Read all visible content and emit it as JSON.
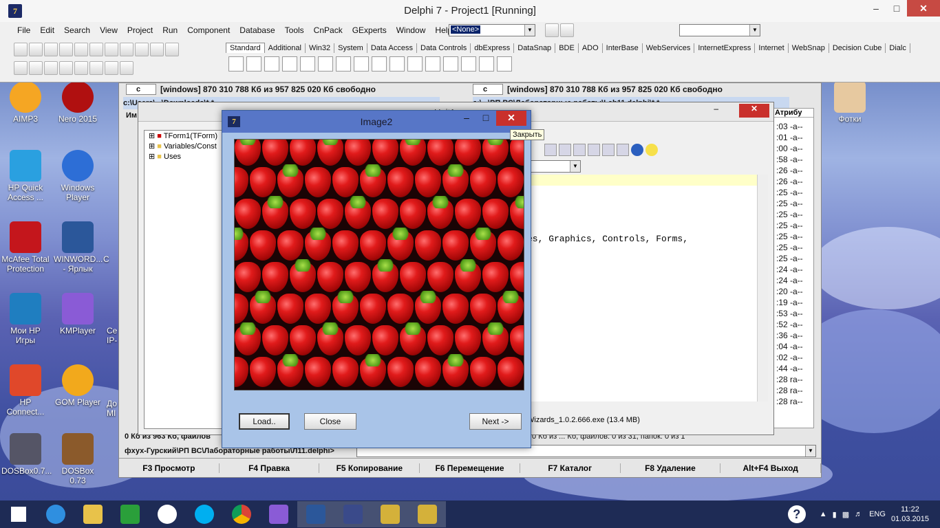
{
  "ide": {
    "title": "Delphi 7 - Project1 [Running]",
    "icon": "delphi-icon",
    "menu": [
      "File",
      "Edit",
      "Search",
      "View",
      "Project",
      "Run",
      "Component",
      "Database",
      "Tools",
      "CnPack",
      "GExperts",
      "Window",
      "Help"
    ],
    "combo_value": "<None>",
    "palette_tabs": [
      "Standard",
      "Additional",
      "Win32",
      "System",
      "Data Access",
      "Data Controls",
      "dbExpress",
      "DataSnap",
      "BDE",
      "ADO",
      "InterBase",
      "WebServices",
      "InternetExpress",
      "Internet",
      "WebSnap",
      "Decision Cube",
      "Dialc"
    ]
  },
  "desktop": {
    "icons": [
      {
        "label": "AIMP3",
        "color": "#f5a623"
      },
      {
        "label": "Nero 2015",
        "color": "#b01010"
      },
      {
        "label": "HP Quick Access ...",
        "color": "#2aa0e0"
      },
      {
        "label": "Windows Player",
        "color": "#2d6ed6"
      },
      {
        "label": "McAfee Total Protection",
        "color": "#c4161c"
      },
      {
        "label": "WINWORD... - Ярлык",
        "color": "#2b579a"
      },
      {
        "label": "Мои HP Игры",
        "color": "#1f7ec0"
      },
      {
        "label": "KMPlayer",
        "color": "#8a5bd6"
      },
      {
        "label": "HP Connect...",
        "color": "#e0482a"
      },
      {
        "label": "GOM Player",
        "color": "#f2a91c"
      },
      {
        "label": "DOSBox0.7...",
        "color": "#556"
      },
      {
        "label": "DOSBox 0.73",
        "color": "#8b5a2b"
      },
      {
        "label": "Фотки",
        "color": "#e7c9a0"
      }
    ],
    "partial": [
      "С",
      "Се",
      "IP-",
      "До",
      "МІ"
    ]
  },
  "tc": {
    "left_path": "[windows]  870 310 788 Кб из 957 825 020 Кб свободно",
    "right_path": "[windows]  870 310 788 Кб из 957 825 020 Кб свободно",
    "drive": "c",
    "left_dir": "c:\\Users\\...\\Downloads\\*.*",
    "right_dir": "c:\\...\\РП ВС\\Лабораторные работы\\Lab11.delphi\\*.*",
    "col_name": "Им",
    "col_attr": "Атрибу",
    "attrs": [
      ":03 -a--",
      ":01 -a--",
      ":00 -a--",
      ":58 -a--",
      ":26 -a--",
      ":26 -a--",
      ":25 -a--",
      ":25 -a--",
      ":25 -a--",
      ":25 -a--",
      ":25 -a--",
      ":25 -a--",
      ":25 -a--",
      ":24 -a--",
      ":24 -a--",
      ":20 -a--",
      ":19 -a--",
      ":53 -a--",
      ":52 -a--",
      ":36 -a--",
      ":04 -a--",
      ":02 -a--",
      ":44 -a--",
      ":28 ra--",
      ":28 ra--",
      ":28 ra--"
    ],
    "left_status": "0 Кб из 963 Кб, файлов",
    "right_status": "Wizards_1.0.2.666.exe (13.4 MB)",
    "right_status2": "0 Кб из ... Кб, файлов: 0 из 31, папок: 0 из 1",
    "cmdline": "фхух-Гурский\\РП ВС\\Лабораторные работы\\Л11.delphi>",
    "fkeys": [
      "F3 Просмотр",
      "F4 Правка",
      "F5 Копирование",
      "F6 Перемещение",
      "F7 Каталог",
      "F8 Удаление",
      "Alt+F4 Выход"
    ]
  },
  "editor": {
    "tab": "Unit1.pas",
    "tree": [
      "TForm1(TForm)",
      "Variables/Const",
      "Uses"
    ],
    "code_line": "es, Graphics, Controls, Forms,"
  },
  "dialog": {
    "title": "Image2",
    "buttons": {
      "load": "Load..",
      "close": "Close",
      "next": "Next ->"
    },
    "tooltip": "Закрыть"
  },
  "taskbar": {
    "lang": "ENG",
    "time": "11:22",
    "date": "01.03.2015"
  }
}
